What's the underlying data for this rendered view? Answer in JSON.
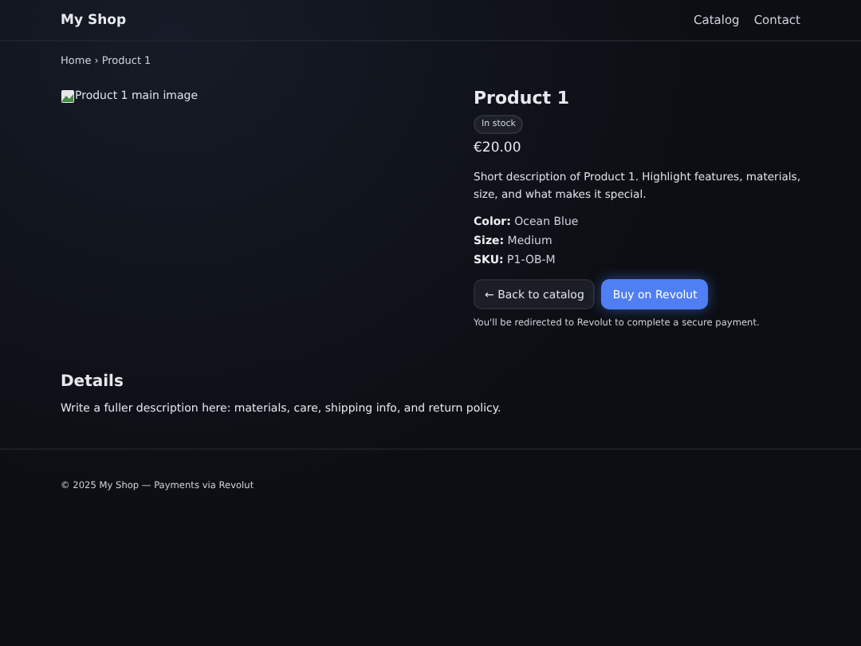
{
  "header": {
    "brand": "My Shop",
    "nav": [
      "Catalog",
      "Contact"
    ]
  },
  "breadcrumb": {
    "items": [
      "Home",
      "Product 1"
    ],
    "separator": "›"
  },
  "image": {
    "alt": "Product 1 main image"
  },
  "product": {
    "title": "Product 1",
    "badge": "In stock",
    "price": "€20.00",
    "description": "Short description of Product 1. Highlight features, materials, size, and what makes it special.",
    "specs": [
      {
        "label": "Color:",
        "value": "Ocean Blue"
      },
      {
        "label": "Size:",
        "value": "Medium"
      },
      {
        "label": "SKU:",
        "value": "P1-OB-M"
      }
    ],
    "buttons": [
      {
        "label": "← Back to catalog",
        "kind": "secondary"
      },
      {
        "label": "Buy on Revolut",
        "kind": "primary"
      }
    ],
    "note": "You'll be redirected to Revolut to complete a secure payment."
  },
  "details": {
    "heading": "Details",
    "text": "Write a fuller description here: materials, care, shipping info, and return policy."
  },
  "footer": {
    "text": "© 2025 My Shop — Payments via Revolut"
  }
}
